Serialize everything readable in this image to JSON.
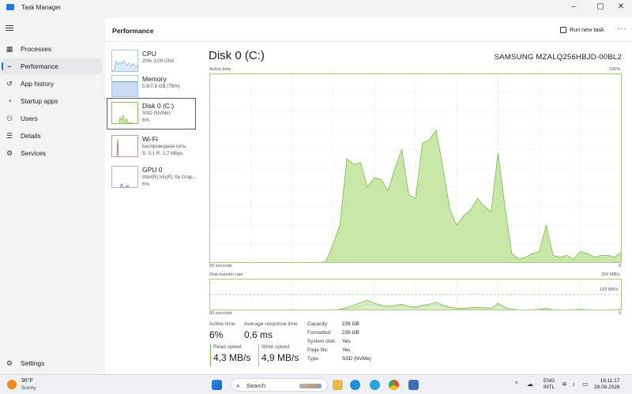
{
  "window": {
    "title": "Task Manager",
    "min": "–",
    "max": "▢",
    "close": "✕"
  },
  "sidebar": {
    "items": [
      {
        "label": "Processes",
        "icon": "grid-icon"
      },
      {
        "label": "Performance",
        "icon": "performance-icon",
        "active": true
      },
      {
        "label": "App history",
        "icon": "history-icon"
      },
      {
        "label": "Startup apps",
        "icon": "startup-icon"
      },
      {
        "label": "Users",
        "icon": "users-icon"
      },
      {
        "label": "Details",
        "icon": "details-icon"
      },
      {
        "label": "Services",
        "icon": "services-icon"
      }
    ],
    "settings": "Settings"
  },
  "header": {
    "title": "Performance",
    "run_task": "Run new task",
    "more": "···"
  },
  "resources": [
    {
      "name": "CPU",
      "line1": "20%  3,00 GHz",
      "line2": ""
    },
    {
      "name": "Memory",
      "line1": "5,9/7,8 GB (76%)",
      "line2": ""
    },
    {
      "name": "Disk 0 (C:)",
      "line1": "SSD (NVMe)",
      "line2": "6%"
    },
    {
      "name": "Wi-Fi",
      "line1": "Беспроводная сеть",
      "line2": "S: 0,1  R: 2,7 Mbps"
    },
    {
      "name": "GPU 0",
      "line1": "Intel(R) Iris(R) Xe Grap...",
      "line2": "6%"
    }
  ],
  "detail": {
    "title": "Disk 0 (C:)",
    "model": "SAMSUNG MZALQ256HBJD-00BL2",
    "active_time_label": "Active time",
    "active_max": "100%",
    "time_left": "60 seconds",
    "time_right": "0",
    "transfer_label": "Disk transfer rate",
    "transfer_max": "250 MB/s",
    "transfer_mid": "125 MB/s",
    "time_left2": "60 seconds",
    "time_right2": "0"
  },
  "chart_data": [
    {
      "type": "area",
      "title": "Active time",
      "ylim": [
        0,
        100
      ],
      "x": [
        0,
        1,
        2,
        3,
        4,
        5,
        6,
        7,
        8,
        9,
        10,
        11,
        12,
        13,
        14,
        15,
        16,
        17,
        18,
        19,
        20,
        21,
        22,
        23,
        24,
        25,
        26,
        27,
        28,
        29,
        30,
        31,
        32,
        33,
        34,
        35,
        36,
        37,
        38,
        39,
        40,
        41,
        42,
        43,
        44,
        45,
        46,
        47,
        48,
        49,
        50,
        51,
        52,
        53,
        54,
        55,
        56,
        57,
        58,
        59,
        60
      ],
      "values": [
        0,
        0,
        0,
        0,
        0,
        0,
        0,
        0,
        0,
        0,
        0,
        0,
        0,
        0,
        0,
        0,
        0,
        1,
        10,
        20,
        55,
        52,
        53,
        40,
        45,
        44,
        38,
        50,
        60,
        36,
        34,
        63,
        65,
        70,
        50,
        28,
        20,
        25,
        28,
        34,
        30,
        27,
        58,
        30,
        5,
        2,
        3,
        5,
        6,
        20,
        4,
        3,
        4,
        2,
        6,
        5,
        3,
        4,
        4,
        3,
        6
      ],
      "grid": true
    },
    {
      "type": "line",
      "title": "Disk transfer rate",
      "ylim": [
        0,
        250
      ],
      "series": [
        {
          "name": "Read speed",
          "values": [
            0,
            0,
            0,
            0,
            0,
            0,
            0,
            0,
            0,
            0,
            0,
            0,
            0,
            0,
            0,
            0,
            0,
            0,
            0,
            2,
            6,
            10,
            15,
            20,
            14,
            10,
            8,
            10,
            12,
            8,
            6,
            10,
            12,
            16,
            10,
            6,
            4,
            4,
            5,
            6,
            5,
            4,
            14,
            6,
            2,
            1,
            1,
            1,
            2,
            4,
            1,
            1,
            1,
            1,
            2,
            1,
            1,
            1,
            1,
            1,
            2
          ]
        },
        {
          "name": "Write speed",
          "values": [
            0,
            0,
            0,
            0,
            0,
            0,
            0,
            0,
            0,
            0,
            0,
            0,
            0,
            0,
            0,
            0,
            0,
            0,
            0,
            1,
            3,
            5,
            8,
            12,
            10,
            8,
            6,
            7,
            9,
            6,
            5,
            8,
            9,
            12,
            8,
            5,
            3,
            3,
            4,
            5,
            4,
            3,
            10,
            5,
            2,
            1,
            1,
            1,
            1,
            3,
            1,
            1,
            1,
            1,
            2,
            1,
            1,
            1,
            1,
            1,
            2
          ]
        }
      ],
      "grid": true
    }
  ],
  "stats": {
    "active_time_label": "Active time",
    "active_time": "6%",
    "avg_resp_label": "Average response time",
    "avg_resp": "0,6 ms",
    "read_label": "Read speed",
    "read": "4,3 MB/s",
    "write_label": "Write speed",
    "write": "4,9 MB/s"
  },
  "props": [
    {
      "label": "Capacity:",
      "value": "239 GB"
    },
    {
      "label": "Formatted:",
      "value": "239 GB"
    },
    {
      "label": "System disk:",
      "value": "Yes"
    },
    {
      "label": "Page file:",
      "value": "Yes"
    },
    {
      "label": "Type:",
      "value": "SSD (NVMe)"
    }
  ],
  "taskbar": {
    "temp": "96°F",
    "weather": "Sunny",
    "search": "Search",
    "lang1": "ENG",
    "lang2": "INTL",
    "time": "16:11:17",
    "date": "28.08.2026"
  },
  "colors": {
    "accent": "#1e6fd0",
    "disk_fill": "#c9e7a6",
    "disk_line": "#7fb94e",
    "grid": "#e6efe0"
  }
}
